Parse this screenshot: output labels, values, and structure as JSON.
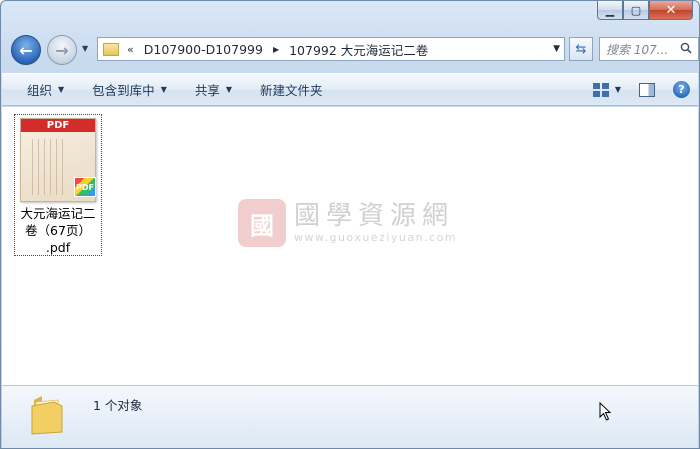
{
  "window": {
    "caption": {
      "minimize": "▁",
      "maximize": "▢",
      "close": "✕"
    }
  },
  "nav": {
    "back_glyph": "←",
    "forward_glyph": "→",
    "chevron": "«",
    "breadcrumbs": [
      "D107900-D107999",
      "107992 大元海运记二卷"
    ],
    "search_placeholder": "搜索 107..."
  },
  "toolbar": {
    "organize": "组织",
    "include_library": "包含到库中",
    "share": "共享",
    "new_folder": "新建文件夹",
    "help": "?"
  },
  "files": [
    {
      "name_line1": "大元海运记二",
      "name_line2": "卷（67页）",
      "name_line3": ".pdf",
      "thumb_header": "PDF",
      "badge": "PDF",
      "icon": "pdf-file-icon"
    }
  ],
  "watermark": {
    "logo_glyph": "國",
    "title": "國學資源網",
    "url": "www.guoxueziyuan.com"
  },
  "status": {
    "count_text": "1 个对象"
  }
}
